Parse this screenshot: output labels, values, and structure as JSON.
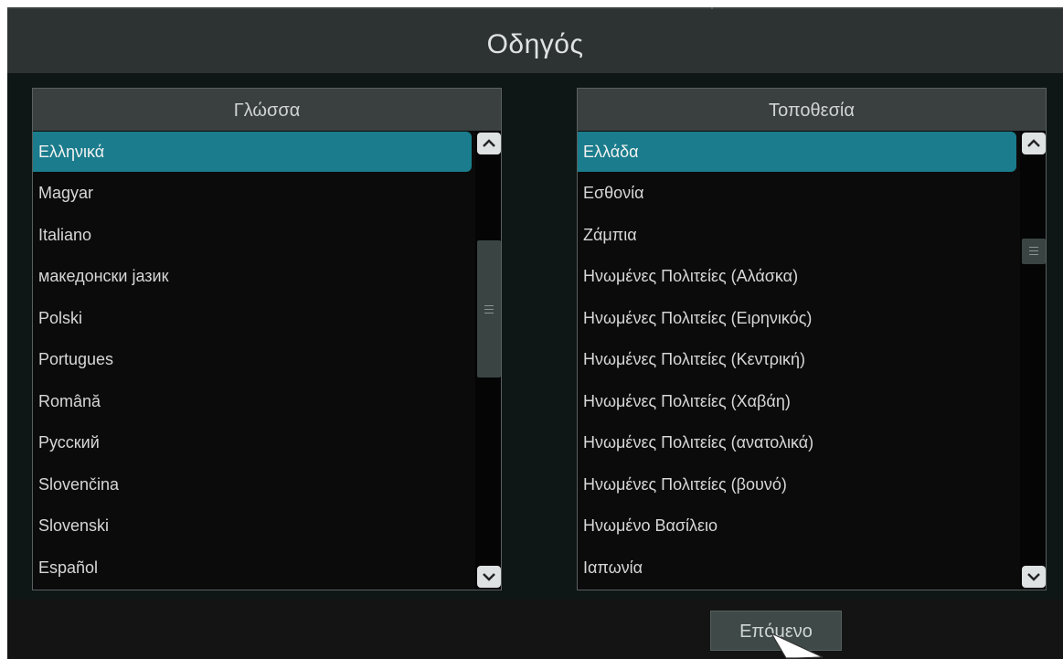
{
  "window": {
    "title": "Οδηγός"
  },
  "language_panel": {
    "header": "Γλώσσα",
    "selected_index": 0,
    "items": [
      "Ελληνικά",
      "Magyar",
      "Italiano",
      "македонски јазик",
      "Polski",
      "Portugues",
      "Română",
      "Русский",
      "Slovenčina",
      "Slovenski",
      "Español"
    ]
  },
  "location_panel": {
    "header": "Τοποθεσία",
    "selected_index": 0,
    "items": [
      "Ελλάδα",
      "Εσθονία",
      "Ζάμπια",
      "Ηνωμένες Πολιτείες (Αλάσκα)",
      "Ηνωμένες Πολιτείες (Ειρηνικός)",
      "Ηνωμένες Πολιτείες (Κεντρική)",
      "Ηνωμένες Πολιτείες (Χαβάη)",
      "Ηνωμένες Πολιτείες (ανατολικά)",
      "Ηνωμένες Πολιτείες (βουνό)",
      "Ηνωμένο Βασίλειο",
      "Ιαπωνία"
    ]
  },
  "footer": {
    "next_label": "Επόμενο"
  },
  "icons": {
    "scroll_up": "chevron-up-icon",
    "scroll_down": "chevron-down-icon",
    "pointer": "mouse-pointer-icon"
  },
  "colors": {
    "selection": "#1a7c8c",
    "header_bg": "#3a3f3f",
    "titlebar_bg": "#2d3332"
  }
}
